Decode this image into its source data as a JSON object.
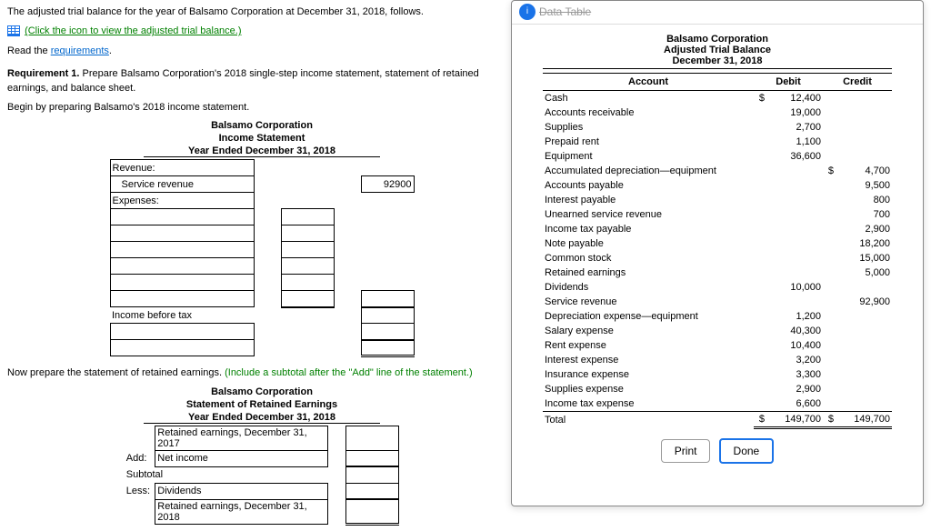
{
  "left": {
    "intro": "The adjusted trial balance for the year of Balsamo Corporation at December 31, 2018, follows.",
    "click_icon": "(Click the icon to view the adjusted trial balance.)",
    "read_the": "Read the ",
    "requirements": "requirements",
    "period": ".",
    "req1_label": "Requirement 1.",
    "req1_text": " Prepare Balsamo Corporation's 2018 single-step income statement, statement of retained earnings, and balance sheet.",
    "begin": "Begin by preparing Balsamo's 2018 income statement.",
    "inc_company": "Balsamo Corporation",
    "inc_title": "Income Statement",
    "inc_period": "Year Ended December 31, 2018",
    "revenue_label": "Revenue:",
    "service_rev": "Service revenue",
    "service_rev_val": "92900",
    "expenses_label": "Expenses:",
    "income_before_tax": "Income before tax",
    "now_prepare": "Now prepare the statement of retained earnings. ",
    "include_subtotal": "(Include a subtotal after the \"Add\" line of the statement.)",
    "re_company": "Balsamo Corporation",
    "re_title": "Statement of Retained Earnings",
    "re_period": "Year Ended December 31, 2018",
    "re_2017": "Retained earnings, December 31, 2017",
    "add": "Add:",
    "net_income": "Net income",
    "subtotal": "Subtotal",
    "less": "Less:",
    "dividends": "Dividends",
    "re_2018": "Retained earnings, December 31, 2018"
  },
  "modal": {
    "title_strike": "Data Table",
    "company": "Balsamo Corporation",
    "subtitle": "Adjusted Trial Balance",
    "date": "December 31, 2018",
    "col_account": "Account",
    "col_debit": "Debit",
    "col_credit": "Credit",
    "rows": [
      {
        "a": "Cash",
        "d": "12,400",
        "c": ""
      },
      {
        "a": "Accounts receivable",
        "d": "19,000",
        "c": ""
      },
      {
        "a": "Supplies",
        "d": "2,700",
        "c": ""
      },
      {
        "a": "Prepaid rent",
        "d": "1,100",
        "c": ""
      },
      {
        "a": "Equipment",
        "d": "36,600",
        "c": ""
      },
      {
        "a": "Accumulated depreciation—equipment",
        "d": "",
        "c": "4,700"
      },
      {
        "a": "Accounts payable",
        "d": "",
        "c": "9,500"
      },
      {
        "a": "Interest payable",
        "d": "",
        "c": "800"
      },
      {
        "a": "Unearned service revenue",
        "d": "",
        "c": "700"
      },
      {
        "a": "Income tax payable",
        "d": "",
        "c": "2,900"
      },
      {
        "a": "Note payable",
        "d": "",
        "c": "18,200"
      },
      {
        "a": "Common stock",
        "d": "",
        "c": "15,000"
      },
      {
        "a": "Retained earnings",
        "d": "",
        "c": "5,000"
      },
      {
        "a": "Dividends",
        "d": "10,000",
        "c": ""
      },
      {
        "a": "Service revenue",
        "d": "",
        "c": "92,900"
      },
      {
        "a": "Depreciation expense—equipment",
        "d": "1,200",
        "c": ""
      },
      {
        "a": "Salary expense",
        "d": "40,300",
        "c": ""
      },
      {
        "a": "Rent expense",
        "d": "10,400",
        "c": ""
      },
      {
        "a": "Interest expense",
        "d": "3,200",
        "c": ""
      },
      {
        "a": "Insurance expense",
        "d": "3,300",
        "c": ""
      },
      {
        "a": "Supplies expense",
        "d": "2,900",
        "c": ""
      },
      {
        "a": "Income tax expense",
        "d": "6,600",
        "c": ""
      }
    ],
    "total_label": "Total",
    "total_debit": "149,700",
    "total_credit": "149,700",
    "print": "Print",
    "done": "Done"
  }
}
